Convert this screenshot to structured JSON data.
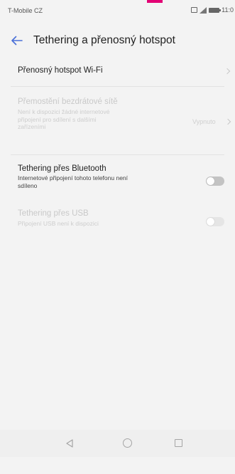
{
  "status_bar": {
    "carrier": "T-Mobile CZ",
    "time": "11:0"
  },
  "header": {
    "title": "Tethering a přenosný hotspot",
    "back_icon": "arrow-left-icon"
  },
  "rows": {
    "hotspot": {
      "title": "Přenosný hotspot Wi-Fi"
    },
    "bridge": {
      "title": "Přemostění bezdrátové sítě",
      "subtitle_lines": [
        "Není k dispozici žádné internetové",
        "připojení pro sdílení s dalšími",
        "zařízeními"
      ],
      "value": "Vypnuto"
    },
    "bluetooth": {
      "title": "Tethering přes Bluetooth",
      "subtitle_lines": [
        "Internetové připojení tohoto telefonu není",
        "sdíleno"
      ],
      "enabled": false
    },
    "usb": {
      "title": "Tethering přes USB",
      "subtitle_lines": [
        "Připojení USB není k dispozici"
      ],
      "enabled": false
    }
  },
  "nav": {
    "back": "nav-back-icon",
    "home": "nav-home-icon",
    "recents": "nav-recents-icon"
  },
  "colors": {
    "brand": "#e20074",
    "background": "#f3f3f3",
    "accent_back": "#4a6fd8"
  }
}
